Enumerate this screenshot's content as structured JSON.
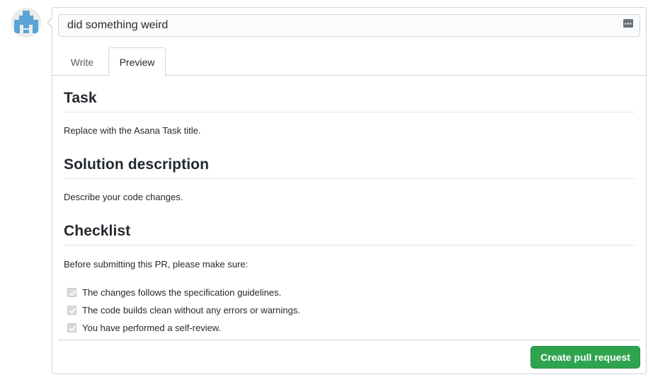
{
  "pr_form": {
    "title_value": "did something weird",
    "tabs": [
      {
        "label": "Write"
      },
      {
        "label": "Preview"
      }
    ],
    "active_tab": "Preview",
    "preview": {
      "task_heading": "Task",
      "task_text": "Replace with the Asana Task title.",
      "solution_heading": "Solution description",
      "solution_text": "Describe your code changes.",
      "checklist_heading": "Checklist",
      "checklist_intro": "Before submitting this PR, please make sure:",
      "checklist_items": [
        {
          "label": "The changes follows the specification guidelines.",
          "checked": true
        },
        {
          "label": "The code builds clean without any errors or warnings.",
          "checked": true
        },
        {
          "label": "You have performed a self-review.",
          "checked": true
        }
      ]
    },
    "submit_label": "Create pull request"
  },
  "icons": {
    "avatar": "identicon-avatar",
    "saved_replies": "saved-replies-icon"
  },
  "colors": {
    "accent_green": "#2ea44f",
    "avatar_blue": "#5aa4d6",
    "border": "#d1d5da"
  }
}
